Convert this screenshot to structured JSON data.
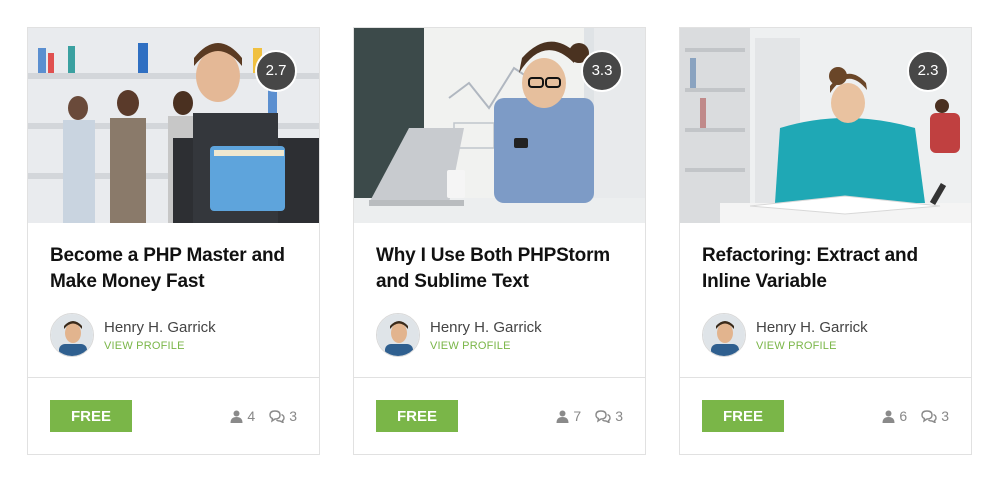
{
  "courses": [
    {
      "rating": "2.7",
      "title": "Become a PHP Master and Make Money Fast",
      "author_name": "Henry H. Garrick",
      "view_profile": "VIEW PROFILE",
      "price": "FREE",
      "students": "4",
      "comments": "3"
    },
    {
      "rating": "3.3",
      "title": "Why I Use Both PHPStorm and Sublime Text",
      "author_name": "Henry H. Garrick",
      "view_profile": "VIEW PROFILE",
      "price": "FREE",
      "students": "7",
      "comments": "3"
    },
    {
      "rating": "2.3",
      "title": "Refactoring: Extract and Inline Variable",
      "author_name": "Henry H. Garrick",
      "view_profile": "VIEW PROFILE",
      "price": "FREE",
      "students": "6",
      "comments": "3"
    }
  ],
  "icons": {
    "students": "user-icon",
    "comments": "comments-icon"
  },
  "colors": {
    "accent": "#7ab648",
    "rating_badge": "#474747",
    "border": "#e1e1e1"
  }
}
